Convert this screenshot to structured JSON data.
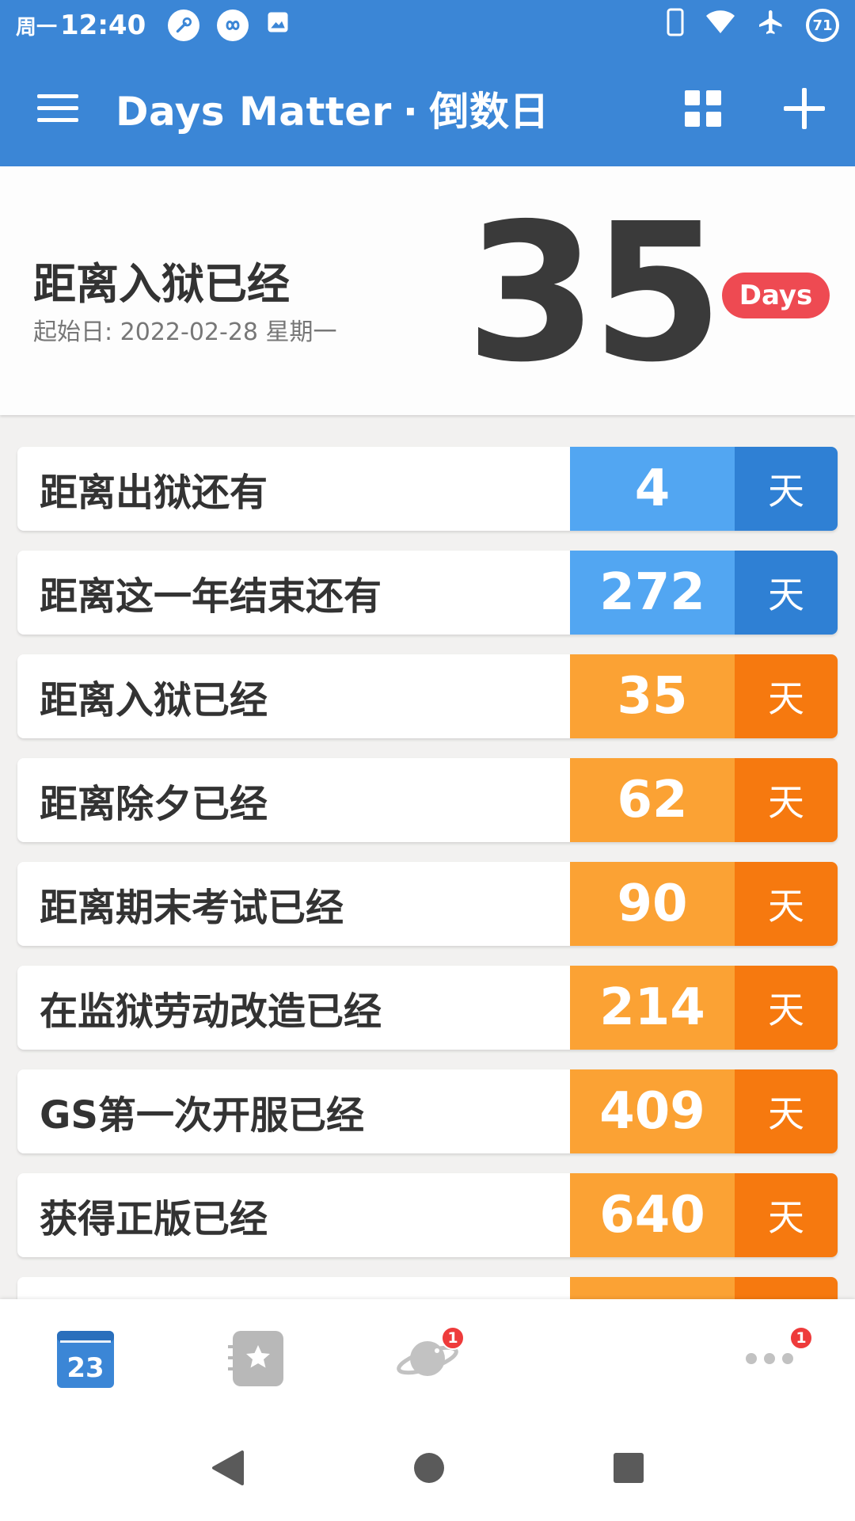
{
  "status_bar": {
    "day": "周一",
    "time": "12:40",
    "battery": "71"
  },
  "app_bar": {
    "title": "Days Matter",
    "separator": "·",
    "subtitle": "倒数日"
  },
  "hero": {
    "title": "距离入狱已经",
    "start_date_text": "起始日: 2022-02-28 星期一",
    "days": "35",
    "badge": "Days"
  },
  "events": [
    {
      "label": "距离出狱还有",
      "days": "4",
      "unit": "天",
      "kind": "future"
    },
    {
      "label": "距离这一年结束还有",
      "days": "272",
      "unit": "天",
      "kind": "future"
    },
    {
      "label": "距离入狱已经",
      "days": "35",
      "unit": "天",
      "kind": "past"
    },
    {
      "label": "距离除夕已经",
      "days": "62",
      "unit": "天",
      "kind": "past"
    },
    {
      "label": "距离期末考试已经",
      "days": "90",
      "unit": "天",
      "kind": "past"
    },
    {
      "label": "在监狱劳动改造已经",
      "days": "214",
      "unit": "天",
      "kind": "past"
    },
    {
      "label": "GS第一次开服已经",
      "days": "409",
      "unit": "天",
      "kind": "past"
    },
    {
      "label": "获得正版已经",
      "days": "640",
      "unit": "天",
      "kind": "past"
    }
  ],
  "bottom_nav": {
    "calendar_day": "23",
    "explore_badge": "1",
    "more_badge": "1"
  },
  "colors": {
    "primary": "#3b86d6",
    "future_num": "#52a6f2",
    "future_unit": "#2f80d4",
    "past_num": "#fba234",
    "past_unit": "#f6790f",
    "badge": "#ee4a52"
  }
}
